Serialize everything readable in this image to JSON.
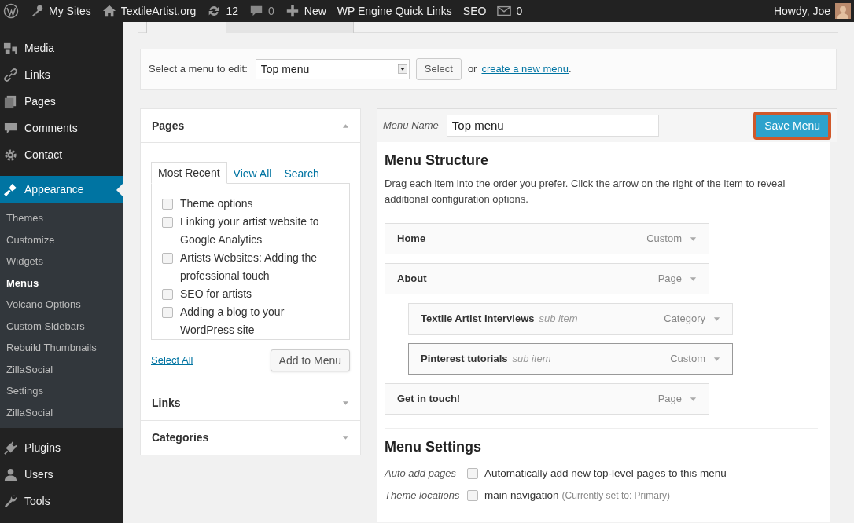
{
  "admin_bar": {
    "items": [
      {
        "kind": "logo"
      },
      {
        "kind": "sites",
        "label": "My Sites"
      },
      {
        "kind": "home",
        "label": "TextileArtist.org"
      },
      {
        "kind": "updates",
        "label": "12"
      },
      {
        "kind": "comments",
        "label": "0"
      },
      {
        "kind": "new",
        "label": "New"
      },
      {
        "kind": "text",
        "label": "WP Engine Quick Links"
      },
      {
        "kind": "text",
        "label": "SEO"
      },
      {
        "kind": "mail",
        "label": "0"
      }
    ],
    "greeting": "Howdy, Joe"
  },
  "sidebar": {
    "items": [
      {
        "label": "Media",
        "selected": false
      },
      {
        "label": "Links",
        "selected": false
      },
      {
        "label": "Pages",
        "selected": false
      },
      {
        "label": "Comments",
        "selected": false
      },
      {
        "label": "Contact",
        "selected": false
      },
      {
        "label": "Appearance",
        "selected": true,
        "children": [
          {
            "label": "Themes",
            "selected": false
          },
          {
            "label": "Customize",
            "selected": false
          },
          {
            "label": "Widgets",
            "selected": false
          },
          {
            "label": "Menus",
            "selected": true
          },
          {
            "label": "Volcano Options",
            "selected": false
          },
          {
            "label": "Custom Sidebars",
            "selected": false
          },
          {
            "label": "Rebuild Thumbnails",
            "selected": false
          },
          {
            "label": "ZillaSocial",
            "selected": false
          },
          {
            "label": "Settings",
            "selected": false
          },
          {
            "label": "ZillaSocial",
            "selected": false
          }
        ]
      },
      {
        "label": "Plugins",
        "selected": false
      },
      {
        "label": "Users",
        "selected": false
      },
      {
        "label": "Tools",
        "selected": false
      }
    ]
  },
  "menu_select": {
    "label": "Select a menu to edit:",
    "value": "Top menu",
    "button": "Select",
    "or_text": "or",
    "link": "create a new menu",
    "after_link": "."
  },
  "left_panels": [
    {
      "title": "Pages",
      "expanded": true,
      "tabs": [
        {
          "label": "Most Recent",
          "selected": true
        },
        {
          "label": "View All",
          "selected": false
        },
        {
          "label": "Search",
          "selected": false
        }
      ],
      "items": [
        {
          "label": "Theme options",
          "checked": false
        },
        {
          "label": "Linking your artist website to Google Analytics",
          "checked": false
        },
        {
          "label": "Artists Websites: Adding the professional touch",
          "checked": false
        },
        {
          "label": "SEO for artists",
          "checked": false
        },
        {
          "label": "Adding a blog to your WordPress site",
          "checked": false
        }
      ],
      "select_all": "Select All",
      "add_button": "Add to Menu"
    },
    {
      "title": "Links",
      "expanded": false
    },
    {
      "title": "Categories",
      "expanded": false
    }
  ],
  "menu_editor": {
    "name_label": "Menu Name",
    "name_value": "Top menu",
    "save_button": "Save Menu",
    "structure_title": "Menu Structure",
    "structure_help": "Drag each item into the order you prefer. Click the arrow on the right of the item to reveal additional configuration options.",
    "items": [
      {
        "title": "Home",
        "type": "Custom"
      },
      {
        "title": "About",
        "type": "Page",
        "children": [
          {
            "title": "Textile Artist Interviews",
            "note": "sub item",
            "type": "Category",
            "selected": false
          },
          {
            "title": "Pinterest tutorials",
            "note": "sub item",
            "type": "Custom",
            "selected": true
          }
        ]
      },
      {
        "title": "Get in touch!",
        "type": "Page"
      }
    ],
    "settings_title": "Menu Settings",
    "settings": [
      {
        "label": "Auto add pages",
        "options": [
          {
            "label": "Automatically add new top-level pages to this menu",
            "checked": false
          }
        ]
      },
      {
        "label": "Theme locations",
        "options": [
          {
            "label": "main navigation",
            "hint": "(Currently set to: Primary)",
            "checked": false
          }
        ]
      }
    ]
  }
}
